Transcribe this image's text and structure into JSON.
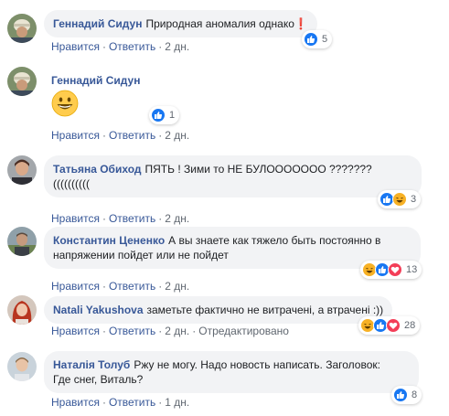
{
  "labels": {
    "like": "Нравится",
    "reply": "Ответить",
    "edited": "Отредактировано",
    "sep": "·"
  },
  "comments": [
    {
      "author": "Геннадий Сидун",
      "text": "Природная аномалия однако❗",
      "time": "2 дн.",
      "reactions": [
        "like"
      ],
      "count": "5"
    },
    {
      "author": "Геннадий Сидун",
      "text": "",
      "emoji": "grinning-face-emoji",
      "time": "2 дн.",
      "reactions": [
        "like"
      ],
      "count": "1"
    },
    {
      "author": "Татьяна Обиход",
      "text": "ПЯТЬ ! Зими то НЕ БУЛООООООО ???????",
      "text2": "((((((((((",
      "time": "2 дн.",
      "reactions": [
        "like",
        "haha"
      ],
      "count": "3"
    },
    {
      "author": "Константин Цененко",
      "text": "А вы знаете как тяжело быть постоянно в",
      "text2": "напряжении пойдет или не пойдет",
      "time": "2 дн.",
      "reactions": [
        "haha",
        "like",
        "love"
      ],
      "count": "13"
    },
    {
      "author": "Natali Yakushova",
      "text": "заметьте фактично не витрачені, а втрачені :))",
      "time": "2 дн.",
      "edited": true,
      "reactions": [
        "haha",
        "like",
        "love"
      ],
      "count": "28"
    },
    {
      "author": "Наталія Толуб",
      "text": "Ржу не могу. Надо новость написать. Заголовок:",
      "text2": "Где снег, Виталь?",
      "time": "1 дн.",
      "reactions": [
        "like"
      ],
      "count": "8"
    }
  ],
  "colors": {
    "link": "#385898",
    "bubble": "#f2f3f5",
    "meta": "#606770",
    "like": "#1877f2",
    "haha": "#f7b125",
    "love": "#f33e58"
  }
}
